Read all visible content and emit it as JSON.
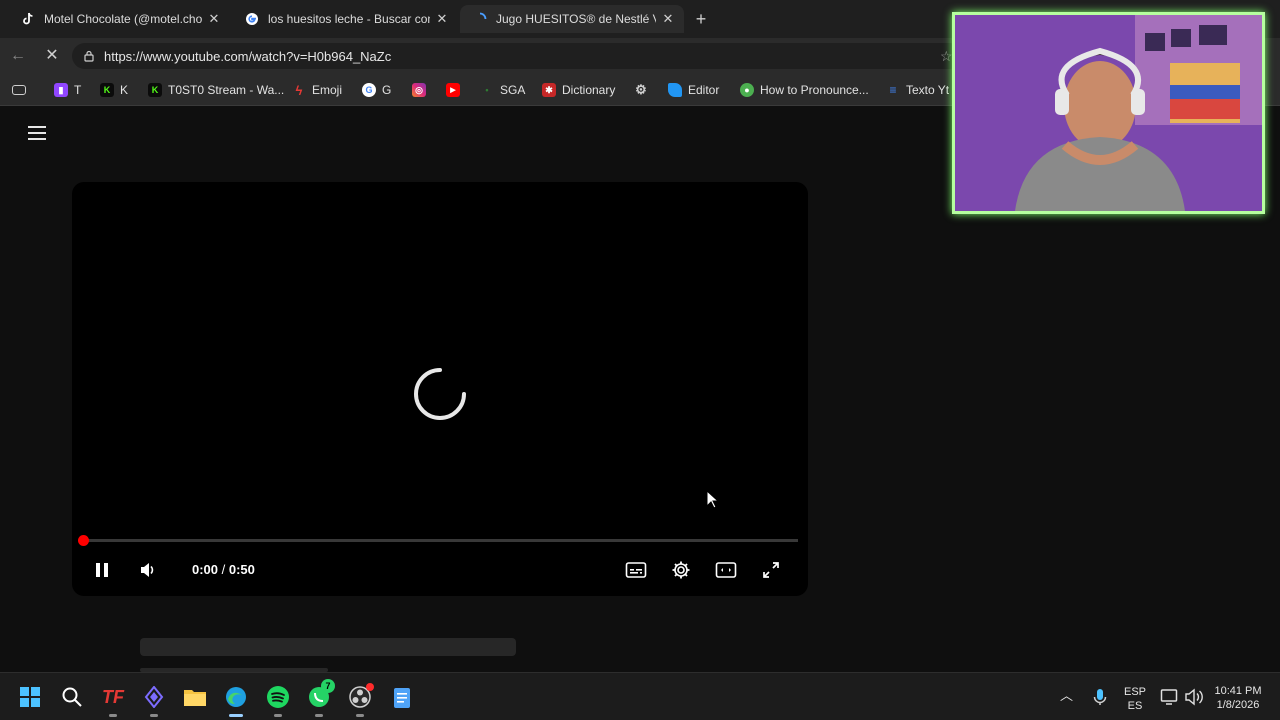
{
  "browser": {
    "tabs": [
      {
        "title": "Motel Chocolate (@motel.chocolate",
        "favicon": "tiktok-icon",
        "active": false
      },
      {
        "title": "los huesitos leche - Buscar con Go",
        "favicon": "google-icon",
        "active": false
      },
      {
        "title": "Jugo HUESITOS® de Nestlé Video",
        "favicon": "loading-icon",
        "active": true
      }
    ],
    "new_tab_label": "+",
    "url": "https://www.youtube.com/watch?v=H0b964_NaZc",
    "bookmarks": [
      {
        "label": "",
        "icon": "tabs-icon"
      },
      {
        "label": "T",
        "icon": "twitch-icon",
        "color": "#9146ff"
      },
      {
        "label": "K",
        "icon": "kick-icon",
        "color": "#53fc18"
      },
      {
        "label": "T0ST0 Stream - Wa...",
        "icon": "kick-icon",
        "color": "#53fc18"
      },
      {
        "label": "Emoji",
        "icon": "bolt-icon",
        "color": "#e53935"
      },
      {
        "label": "G",
        "icon": "google-icon",
        "color": "#ffffff"
      },
      {
        "label": "",
        "icon": "instagram-icon",
        "color": "#d6249f"
      },
      {
        "label": "",
        "icon": "youtube-icon",
        "color": "#ff0000"
      },
      {
        "label": "SGA",
        "icon": "sga-icon",
        "color": "#2e7d32"
      },
      {
        "label": "Dictionary",
        "icon": "dictionary-icon",
        "color": "#c62828"
      },
      {
        "label": "",
        "icon": "openai-icon",
        "color": "#cfcfcf"
      },
      {
        "label": "Editor",
        "icon": "editor-icon",
        "color": "#2196f3"
      },
      {
        "label": "How to Pronounce...",
        "icon": "pronounce-icon",
        "color": "#4caf50"
      },
      {
        "label": "Texto Yt",
        "icon": "doc-icon",
        "color": "#4285f4"
      }
    ]
  },
  "player": {
    "current_time": "0:00",
    "separator": " / ",
    "duration": "0:50",
    "progress_fraction": 0.0,
    "state": "loading",
    "controls": [
      "pause-icon",
      "volume-icon",
      "subtitles-icon",
      "settings-icon",
      "theater-mode-icon",
      "fullscreen-icon"
    ]
  },
  "taskbar": {
    "apps": [
      "windows-start-icon",
      "search-icon",
      "tf-app-icon",
      "proton-icon",
      "file-explorer-icon",
      "edge-browser-icon",
      "spotify-icon",
      "whatsapp-icon",
      "obs-icon",
      "notepad-icon"
    ],
    "whatsapp_badge": "7",
    "language_top": "ESP",
    "language_bottom": "ES",
    "time": "10:41 PM",
    "date": "1/8/2026"
  },
  "colors": {
    "accent_red": "#ff0000",
    "webcam_border": "#b6ff9f",
    "page_bg": "#0f0f0f"
  }
}
